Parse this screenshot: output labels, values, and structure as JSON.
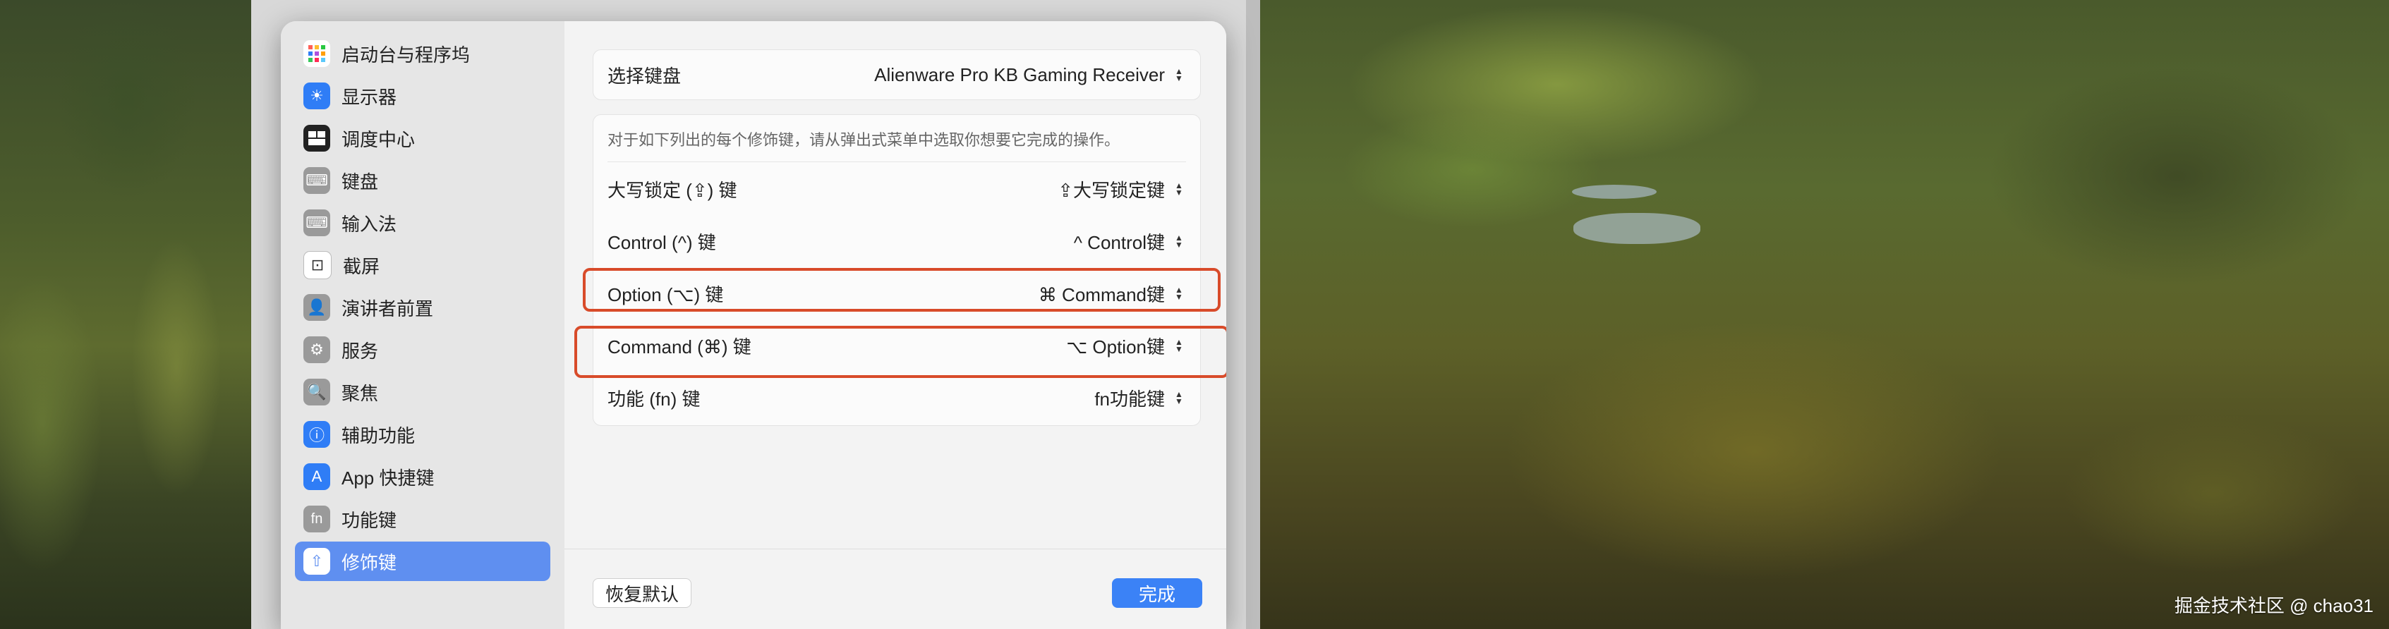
{
  "sidebar": {
    "items": [
      {
        "label": "启动台与程序坞",
        "icon": "launchpad-icon",
        "color": "#ffffff"
      },
      {
        "label": "显示器",
        "icon": "display-icon",
        "color": "#2f7df6"
      },
      {
        "label": "调度中心",
        "icon": "mission-control-icon",
        "color": "#222222"
      },
      {
        "label": "键盘",
        "icon": "keyboard-icon",
        "color": "#9a9a9a"
      },
      {
        "label": "输入法",
        "icon": "input-method-icon",
        "color": "#9a9a9a"
      },
      {
        "label": "截屏",
        "icon": "screenshot-icon",
        "color": "#ffffff"
      },
      {
        "label": "演讲者前置",
        "icon": "presenter-icon",
        "color": "#9a9a9a"
      },
      {
        "label": "服务",
        "icon": "gears-icon",
        "color": "#9a9a9a"
      },
      {
        "label": "聚焦",
        "icon": "spotlight-icon",
        "color": "#9a9a9a"
      },
      {
        "label": "辅助功能",
        "icon": "accessibility-icon",
        "color": "#2f7df6"
      },
      {
        "label": "App 快捷键",
        "icon": "app-store-icon",
        "color": "#2f7df6"
      },
      {
        "label": "功能键",
        "icon": "fn-icon",
        "color": "#9a9a9a"
      },
      {
        "label": "修饰键",
        "icon": "modifier-key-icon",
        "color": "#5f8ff0",
        "active": true
      }
    ]
  },
  "keyboard_select": {
    "label": "选择键盘",
    "value": "Alienware Pro KB Gaming Receiver"
  },
  "modifiers": {
    "description": "对于如下列出的每个修饰键，请从弹出式菜单中选取你想要它完成的操作。",
    "rows": [
      {
        "label": "大写锁定 (⇪) 键",
        "value": "⇪大写锁定键"
      },
      {
        "label": "Control (^) 键",
        "value": "^ Control键"
      },
      {
        "label": "Option (⌥) 键",
        "value": "⌘ Command键"
      },
      {
        "label": "Command (⌘) 键",
        "value": "⌥ Option键"
      },
      {
        "label": "功能 (fn) 键",
        "value": "fn功能键"
      }
    ]
  },
  "footer": {
    "reset_label": "恢复默认",
    "done_label": "完成"
  },
  "watermark": "掘金技术社区 @ chao31",
  "colors": {
    "accent": "#3b82f6",
    "highlight": "#d84b2a",
    "sidebar_active": "#5f8ff0"
  }
}
